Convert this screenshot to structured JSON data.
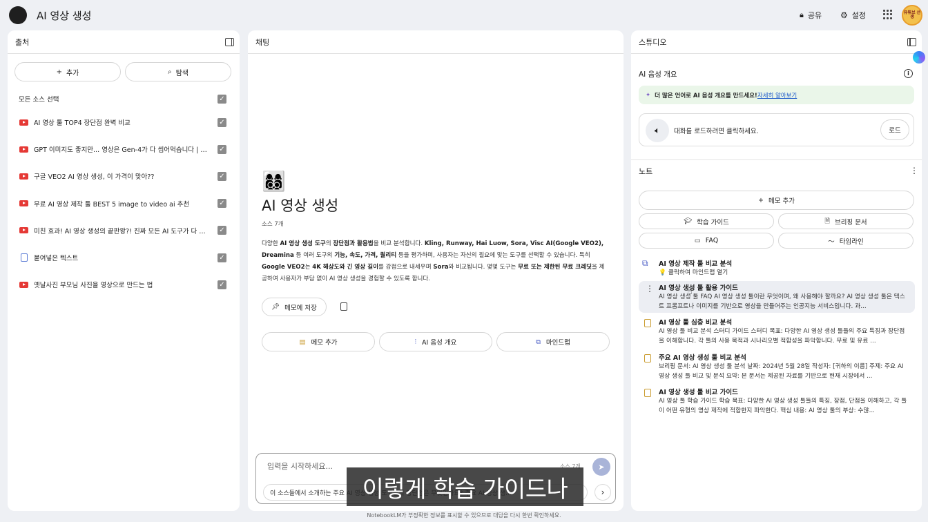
{
  "app": {
    "title": "AI 영상 생성",
    "share_label": "공유",
    "settings_label": "설정",
    "avatar_text": "유튜브 선생"
  },
  "sources": {
    "header": "출처",
    "add_label": "추가",
    "explore_label": "탐색",
    "select_all": "모든 소스 선택",
    "items": [
      {
        "type": "youtube",
        "title": "AI 영상 툴 TOP4 장단점 완벽 비교"
      },
      {
        "type": "youtube",
        "title": "GPT 이미지도 좋지만... 영상은 Gen-4가 다 씹어먹습니다 | R..."
      },
      {
        "type": "youtube",
        "title": "구글 VEO2 AI 영상 생성, 이 가격이 맞아??"
      },
      {
        "type": "youtube",
        "title": "무료 AI 영상 제작 툴 BEST 5 image to video ai 추천"
      },
      {
        "type": "youtube",
        "title": "미친 효과! AI 영상 생성의 끝판왕?! 진짜 모든 AI 도구가 다 들..."
      },
      {
        "type": "text",
        "title": "붙여넣은 텍스트"
      },
      {
        "type": "youtube",
        "title": "옛날사진 부모님 사진을 영상으로 만드는 법"
      }
    ]
  },
  "chat": {
    "header": "채팅",
    "emoji": "👩‍👩‍👦‍👦",
    "title": "AI 영상 생성",
    "source_count": "소스 7개",
    "memo_save": "메모에 저장",
    "actions": [
      "메모 추가",
      "AI 음성 개요",
      "마인드맵"
    ],
    "input_placeholder": "입력을 시작하세요...",
    "input_count": "소스 7개",
    "suggestion": "이 소스들에서 소개하는 주요 AI 영상 생성 도구들의 장단점은 무엇인가요?   주요 AI 영상 생..."
  },
  "caption": "이렇게 학습 가이드나",
  "footer": "NotebookLM가 부정확한 정보를 표시할 수 있으므로 대답을 다시 한번 확인하세요.",
  "studio": {
    "header": "스튜디오",
    "audio_title": "AI 음성 개요",
    "banner_text": "더 많은 언어로 AI 음성 개요를 만드세요!",
    "banner_link": "자세히 알아보기",
    "load_text": "대화를 로드하려면 클릭하세요.",
    "load_button": "로드",
    "notes_title": "노트",
    "add_memo": "메모 추가",
    "chips": [
      "학습 가이드",
      "브리핑 문서",
      "FAQ",
      "타임라인"
    ],
    "notes": [
      {
        "icon": "mindmap",
        "title": "AI 영상 제작 툴 비교 분석",
        "body": "💡 클릭하여 마인드맵 열기"
      },
      {
        "icon": "doc",
        "title": "AI 영상 생성 툴 활용 가이드",
        "body": "AI 영상 생성 툴 FAQ AI 영상 생성 툴이란 무엇이며, 왜 사용해야 할까요? AI 영상 생성 툴은 텍스트 프롬프트나 이미지를 기반으로 영상을 만들어주는 인공지능 서비스입니다. 과..."
      },
      {
        "icon": "doc",
        "title": "AI 영상 툴 심층 비교 분석",
        "body": "AI 영상 툴 비교 분석 스터디 가이드 스터디 목표: 다양한 AI 영상 생성 툴들의 주요 특징과 장단점을 이해합니다. 각 툴의 사용 목적과 시나리오별 적합성을 파악합니다. 무료 및 유료 ..."
      },
      {
        "icon": "doc",
        "title": "주요 AI 영상 생성 툴 비교 분석",
        "body": "브리핑 문서: AI 영상 생성 툴 분석 날짜: 2024년 5월 28일 작성자: [귀하의 이름] 주제: 주요 AI 영상 생성 툴 비교 및 분석 요약: 본 문서는 제공된 자료를 기반으로 현재 시장에서 ..."
      },
      {
        "icon": "doc",
        "title": "AI 영상 생성 툴 비교 가이드",
        "body": "AI 영상 툴 학습 가이드 학습 목표: 다양한 AI 영상 생성 툴들의 특징, 장점, 단점을 이해하고, 각 툴이 어떤 유형의 영상 제작에 적합한지 파악한다. 핵심 내용: AI 영상 툴의 부상: 수많..."
      }
    ]
  }
}
